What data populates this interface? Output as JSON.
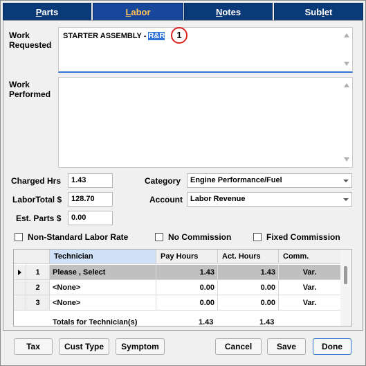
{
  "tabs": [
    {
      "pre": "",
      "u": "P",
      "post": "arts"
    },
    {
      "pre": "",
      "u": "L",
      "post": "abor"
    },
    {
      "pre": "",
      "u": "N",
      "post": "otes"
    },
    {
      "pre": "Sub",
      "u": "l",
      "post": "et"
    }
  ],
  "work_requested": {
    "label1": "Work",
    "label2": "Requested",
    "text": "STARTER ASSEMBLY - ",
    "selected": "R&R",
    "badge": "1"
  },
  "work_performed": {
    "label1": "Work",
    "label2": "Performed",
    "text": ""
  },
  "fields": {
    "charged_hrs_label": "Charged Hrs",
    "charged_hrs": "1.43",
    "labor_total_label": "LaborTotal $",
    "labor_total": "128.70",
    "est_parts_label": "Est. Parts $",
    "est_parts": "0.00",
    "category_label": "Category",
    "category": "Engine Performance/Fuel",
    "account_label": "Account",
    "account": "Labor Revenue"
  },
  "checks": {
    "non_standard": "Non-Standard Labor Rate",
    "no_commission": "No Commission",
    "fixed_commission": "Fixed Commission"
  },
  "grid": {
    "headers": [
      "Technician",
      "Pay Hours",
      "Act. Hours",
      "Comm."
    ],
    "rows": [
      {
        "n": "1",
        "tech": "Please , Select",
        "pay": "1.43",
        "act": "1.43",
        "comm": "Var."
      },
      {
        "n": "2",
        "tech": "<None>",
        "pay": "0.00",
        "act": "0.00",
        "comm": "Var."
      },
      {
        "n": "3",
        "tech": "<None>",
        "pay": "0.00",
        "act": "0.00",
        "comm": "Var."
      }
    ],
    "totals_label": "Totals for Technician(s)",
    "total_pay": "1.43",
    "total_act": "1.43"
  },
  "buttons": {
    "tax": "Tax",
    "cust_type": "Cust Type",
    "symptom": "Symptom",
    "cancel": "Cancel",
    "save": "Save",
    "done": "Done"
  }
}
